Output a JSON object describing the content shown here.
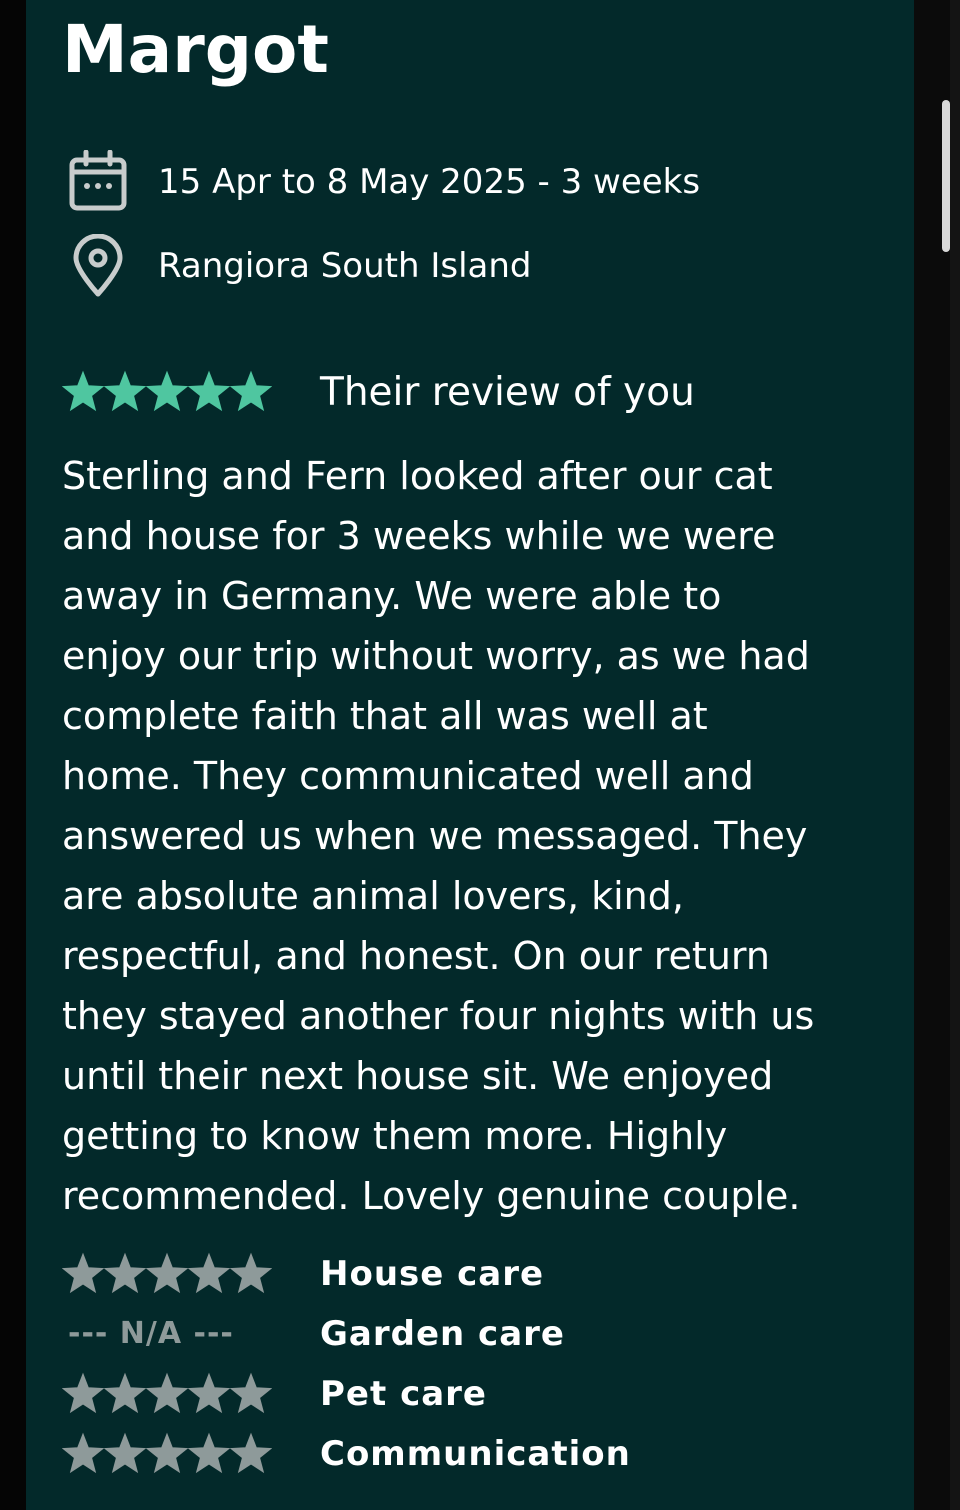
{
  "colors": {
    "card_background": "#03292a",
    "accent_star": "#4fc6a0",
    "grey_star": "#8e9a9a",
    "icon_grey": "#c8cccc",
    "text": "#ffffff"
  },
  "review": {
    "reviewer_name": "Margot",
    "dates": "15 Apr to 8 May 2025 - 3 weeks",
    "location": "Rangiora South Island",
    "date_icon": "calendar-icon",
    "location_icon": "map-pin-icon",
    "overall_rating": 5,
    "overall_rating_max": 5,
    "title": "Their review of you",
    "body_lines": [
      "Sterling and Fern looked after our cat",
      "and house for 3 weeks while we were",
      "away in Germany. We were able to",
      "enjoy our trip without worry, as we had",
      "complete faith that all was well at",
      "home. They communicated well and",
      "answered us when we messaged. They",
      "are absolute animal lovers, kind,",
      "respectful, and honest. On our return",
      "they stayed another four nights with us",
      "until their next house sit. We enjoyed",
      "getting to know them more. Highly",
      "recommended. Lovely genuine couple."
    ],
    "categories": [
      {
        "label": "House care",
        "rating": 5,
        "na_text": null
      },
      {
        "label": "Garden care",
        "rating": null,
        "na_text": "--- N/A ---"
      },
      {
        "label": "Pet care",
        "rating": 5,
        "na_text": null
      },
      {
        "label": "Communication",
        "rating": 5,
        "na_text": null
      }
    ]
  }
}
